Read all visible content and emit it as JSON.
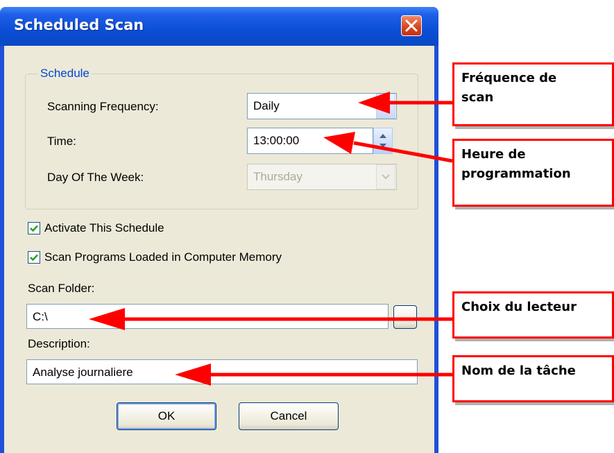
{
  "window": {
    "title": "Scheduled Scan"
  },
  "schedule": {
    "group_label": "Schedule",
    "frequency_label": "Scanning Frequency:",
    "frequency_value": "Daily",
    "time_label": "Time:",
    "time_value": "13:00:00",
    "day_label": "Day Of The Week:",
    "day_value": "Thursday"
  },
  "options": {
    "activate_label": "Activate This Schedule",
    "activate_checked": true,
    "scan_memory_label": "Scan Programs Loaded in Computer Memory",
    "scan_memory_checked": true
  },
  "folder": {
    "label": "Scan Folder:",
    "value": "C:\\",
    "browse_label": "..."
  },
  "description": {
    "label": "Description:",
    "value": "Analyse journaliere"
  },
  "buttons": {
    "ok": "OK",
    "cancel": "Cancel"
  },
  "callouts": {
    "frequency_line1": "Fréquence de",
    "frequency_line2": "scan",
    "time_line1": "Heure de",
    "time_line2": "programmation",
    "folder": "Choix du  lecteur",
    "name": "Nom de la tâche"
  },
  "colors": {
    "arrow": "#ff0000",
    "title_bar": "#0a48c4",
    "dialog_bg": "#ece9d8"
  }
}
